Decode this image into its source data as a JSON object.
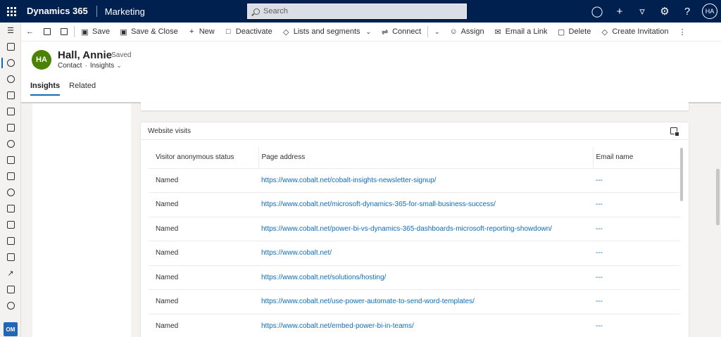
{
  "topbar": {
    "app_name": "Dynamics 365",
    "area": "Marketing",
    "search_placeholder": "Search",
    "user_initials": "HA"
  },
  "leftnav": {
    "badge": "OM"
  },
  "commands": [
    {
      "label": "Save",
      "icon": "save-icon"
    },
    {
      "label": "Save & Close",
      "icon": "save-close-icon"
    },
    {
      "label": "New",
      "icon": "plus-icon"
    },
    {
      "label": "Deactivate",
      "icon": "deactivate-icon"
    },
    {
      "label": "Lists and segments",
      "icon": "tag-icon"
    },
    {
      "label": "Connect",
      "icon": "connect-icon"
    },
    {
      "label": "Assign",
      "icon": "assign-icon"
    },
    {
      "label": "Email a Link",
      "icon": "email-icon"
    },
    {
      "label": "Delete",
      "icon": "trash-icon"
    },
    {
      "label": "Create Invitation",
      "icon": "invitation-icon"
    }
  ],
  "record": {
    "initials": "HA",
    "name": "Hall, Annie",
    "saved": "- Saved",
    "entity": "Contact",
    "form": "Insights",
    "avatar_color": "#498205"
  },
  "tabs": [
    "Insights",
    "Related"
  ],
  "website_visits": {
    "title": "Website visits",
    "columns": [
      "Visitor anonymous status",
      "Page address",
      "Email name"
    ],
    "rows": [
      {
        "status": "Named",
        "page": "https://www.cobalt.net/cobalt-insights-newsletter-signup/",
        "email": "---"
      },
      {
        "status": "Named",
        "page": "https://www.cobalt.net/microsoft-dynamics-365-for-small-business-success/",
        "email": "---"
      },
      {
        "status": "Named",
        "page": "https://www.cobalt.net/power-bi-vs-dynamics-365-dashboards-microsoft-reporting-showdown/",
        "email": "---"
      },
      {
        "status": "Named",
        "page": "https://www.cobalt.net/",
        "email": "---"
      },
      {
        "status": "Named",
        "page": "https://www.cobalt.net/solutions/hosting/",
        "email": "---"
      },
      {
        "status": "Named",
        "page": "https://www.cobalt.net/use-power-automate-to-send-word-templates/",
        "email": "---"
      },
      {
        "status": "Named",
        "page": "https://www.cobalt.net/embed-power-bi-in-teams/",
        "email": "---"
      }
    ]
  },
  "colors": {
    "topbar": "#002050",
    "link": "#0f6cbd",
    "accent": "#0f6cbd"
  }
}
